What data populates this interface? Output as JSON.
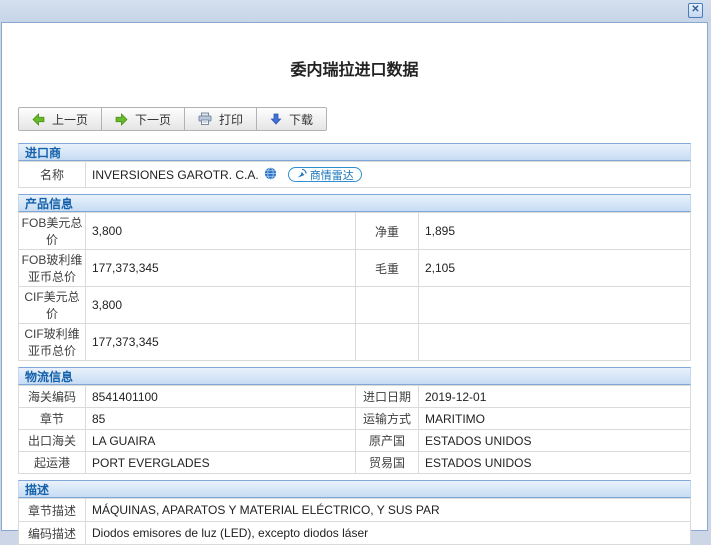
{
  "window": {
    "close_icon": "✕",
    "title": "委内瑞拉进口数据"
  },
  "toolbar": {
    "prev_label": "上一页",
    "next_label": "下一页",
    "print_label": "打印",
    "download_label": "下载"
  },
  "icons": {
    "prev": "green-arrow-left",
    "next": "green-arrow-right",
    "print": "printer",
    "download": "blue-arrow-down",
    "company_site": "globe",
    "radar": "radar-dish",
    "close": "x-mark"
  },
  "colors": {
    "titlebar_bg": "#ccd9ea",
    "dialog_border": "#8aa9d1",
    "section_header_text": "#1661ab",
    "section_header_border": "#7fa7d7",
    "badge_blue": "#1a75bc",
    "arrow_green": "#67bb2a",
    "arrow_blue": "#3f71d6"
  },
  "importer": {
    "section_title": "进口商",
    "name_label": "名称",
    "name_value": "INVERSIONES GAROTR. C.A.",
    "radar_badge_label": "商情雷达"
  },
  "product": {
    "section_title": "产品信息",
    "rows": [
      {
        "l1": "FOB美元总价",
        "v1": "3,800",
        "l2": "净重",
        "v2": "1,895"
      },
      {
        "l1": "FOB玻利维亚币总价",
        "v1": "177,373,345",
        "l2": "毛重",
        "v2": "2,105"
      },
      {
        "l1": "CIF美元总价",
        "v1": "3,800",
        "l2": "",
        "v2": ""
      },
      {
        "l1": "CIF玻利维亚币总价",
        "v1": "177,373,345",
        "l2": "",
        "v2": ""
      }
    ]
  },
  "logistics": {
    "section_title": "物流信息",
    "rows": [
      {
        "l1": "海关编码",
        "v1": "8541401100",
        "l2": "进口日期",
        "v2": "2019-12-01"
      },
      {
        "l1": "章节",
        "v1": "85",
        "l2": "运输方式",
        "v2": "MARITIMO"
      },
      {
        "l1": "出口海关",
        "v1": "LA GUAIRA",
        "l2": "原产国",
        "v2": "ESTADOS UNIDOS"
      },
      {
        "l1": "起运港",
        "v1": "PORT EVERGLADES",
        "l2": "贸易国",
        "v2": "ESTADOS UNIDOS"
      }
    ]
  },
  "description": {
    "section_title": "描述",
    "rows": [
      {
        "l1": "章节描述",
        "v1": "MÁQUINAS, APARATOS Y MATERIAL ELÉCTRICO, Y SUS PAR"
      },
      {
        "l1": "编码描述",
        "v1": "Diodos emisores de luz (LED), excepto diodos láser"
      }
    ]
  }
}
